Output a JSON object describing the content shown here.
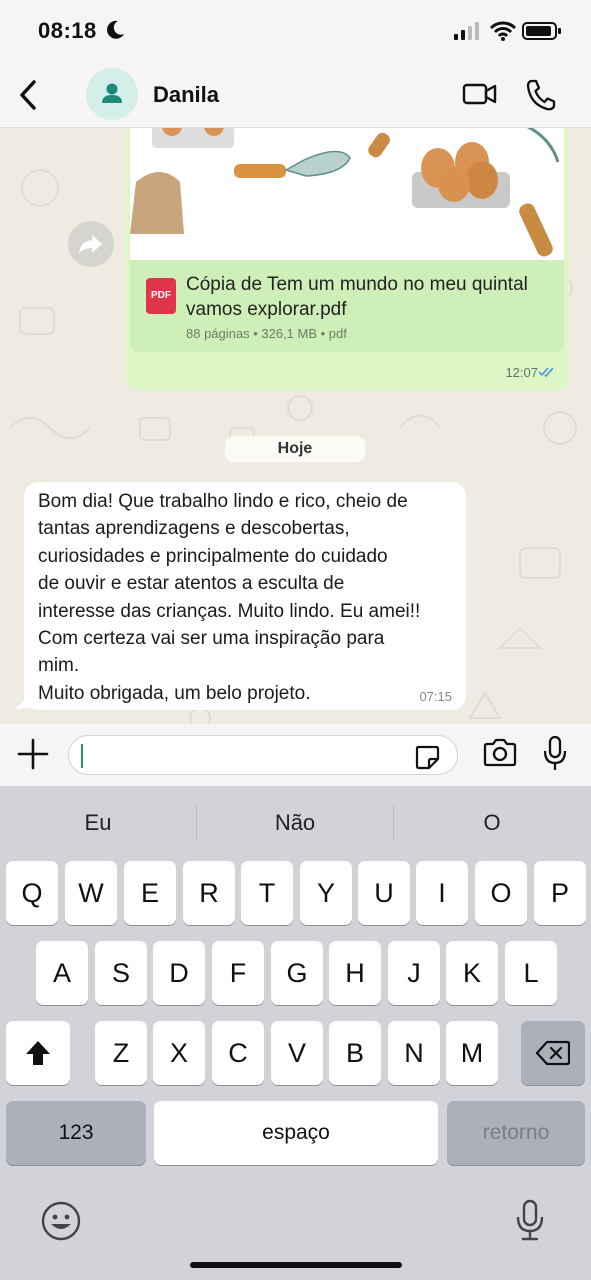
{
  "status": {
    "time": "08:18"
  },
  "header": {
    "contact_name": "Danila"
  },
  "outgoing": {
    "doc_badge": "PDF",
    "file_name": "Cópia de Tem um mundo no meu quintal vamos explorar.pdf",
    "file_meta": "88 páginas • 326,1 MB • pdf",
    "time": "12:07"
  },
  "date_chip": "Hoje",
  "incoming": {
    "text": "Bom dia!  Que trabalho lindo e rico, cheio de\ntantas aprendizagens e descobertas,\ncuriosidades e principalmente do cuidado\nde ouvir e estar atentos a esculta de\ninteresse das crianças. Muito lindo. Eu amei!!\nCom certeza vai ser uma inspiração para\nmim.\nMuito obrigada, um belo projeto.",
    "time": "07:15"
  },
  "composer": {
    "value": ""
  },
  "keyboard": {
    "suggestions": [
      "Eu",
      "Não",
      "O"
    ],
    "row1": [
      "Q",
      "W",
      "E",
      "R",
      "T",
      "Y",
      "U",
      "I",
      "O",
      "P"
    ],
    "row2": [
      "A",
      "S",
      "D",
      "F",
      "G",
      "H",
      "J",
      "K",
      "L"
    ],
    "row3": [
      "Z",
      "X",
      "C",
      "V",
      "B",
      "N",
      "M"
    ],
    "numbers_key": "123",
    "space_key": "espaço",
    "return_key": "retorno"
  },
  "colors": {
    "accent": "#1e9a6a",
    "outgoing_bubble": "#dcf7c5",
    "read_ticks": "#4a90e2",
    "pdf_red": "#e0344a"
  }
}
